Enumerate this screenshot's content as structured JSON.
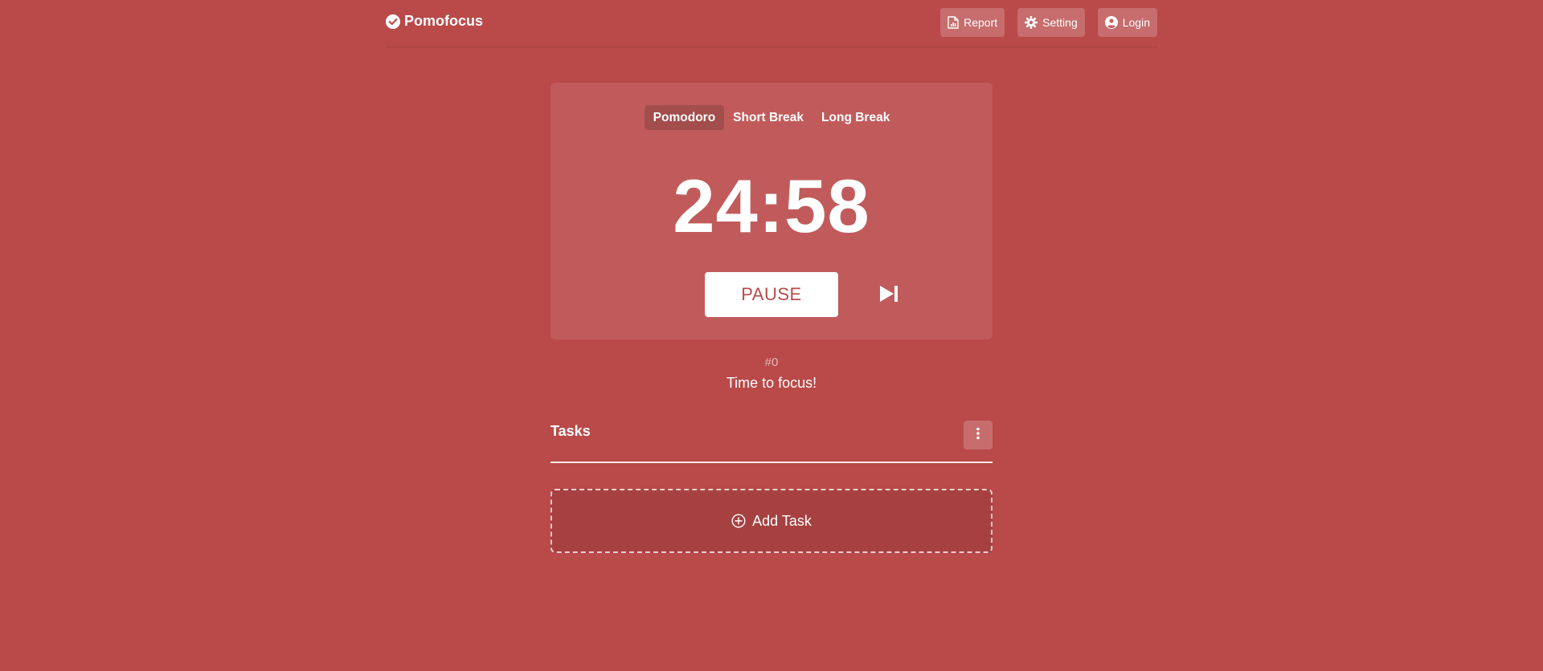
{
  "brand": {
    "name": "Pomofocus",
    "icon": "check-circle-icon"
  },
  "nav": {
    "report": {
      "label": "Report",
      "icon": "report-icon"
    },
    "setting": {
      "label": "Setting",
      "icon": "gear-icon"
    },
    "login": {
      "label": "Login",
      "icon": "user-circle-icon"
    }
  },
  "timer": {
    "modes": [
      "Pomodoro",
      "Short Break",
      "Long Break"
    ],
    "active_mode": "Pomodoro",
    "time": "24:58",
    "pause_label": "PAUSE",
    "skip_icon": "skip-next-icon"
  },
  "session": {
    "counter": "#0",
    "message": "Time to focus!"
  },
  "tasks": {
    "title": "Tasks",
    "menu_icon": "kebab-menu-icon",
    "add_label": "Add Task",
    "add_icon": "plus-circle-icon"
  },
  "colors": {
    "background": "#ba4949",
    "accent_text": "#ba4949",
    "foreground": "#ffffff"
  }
}
